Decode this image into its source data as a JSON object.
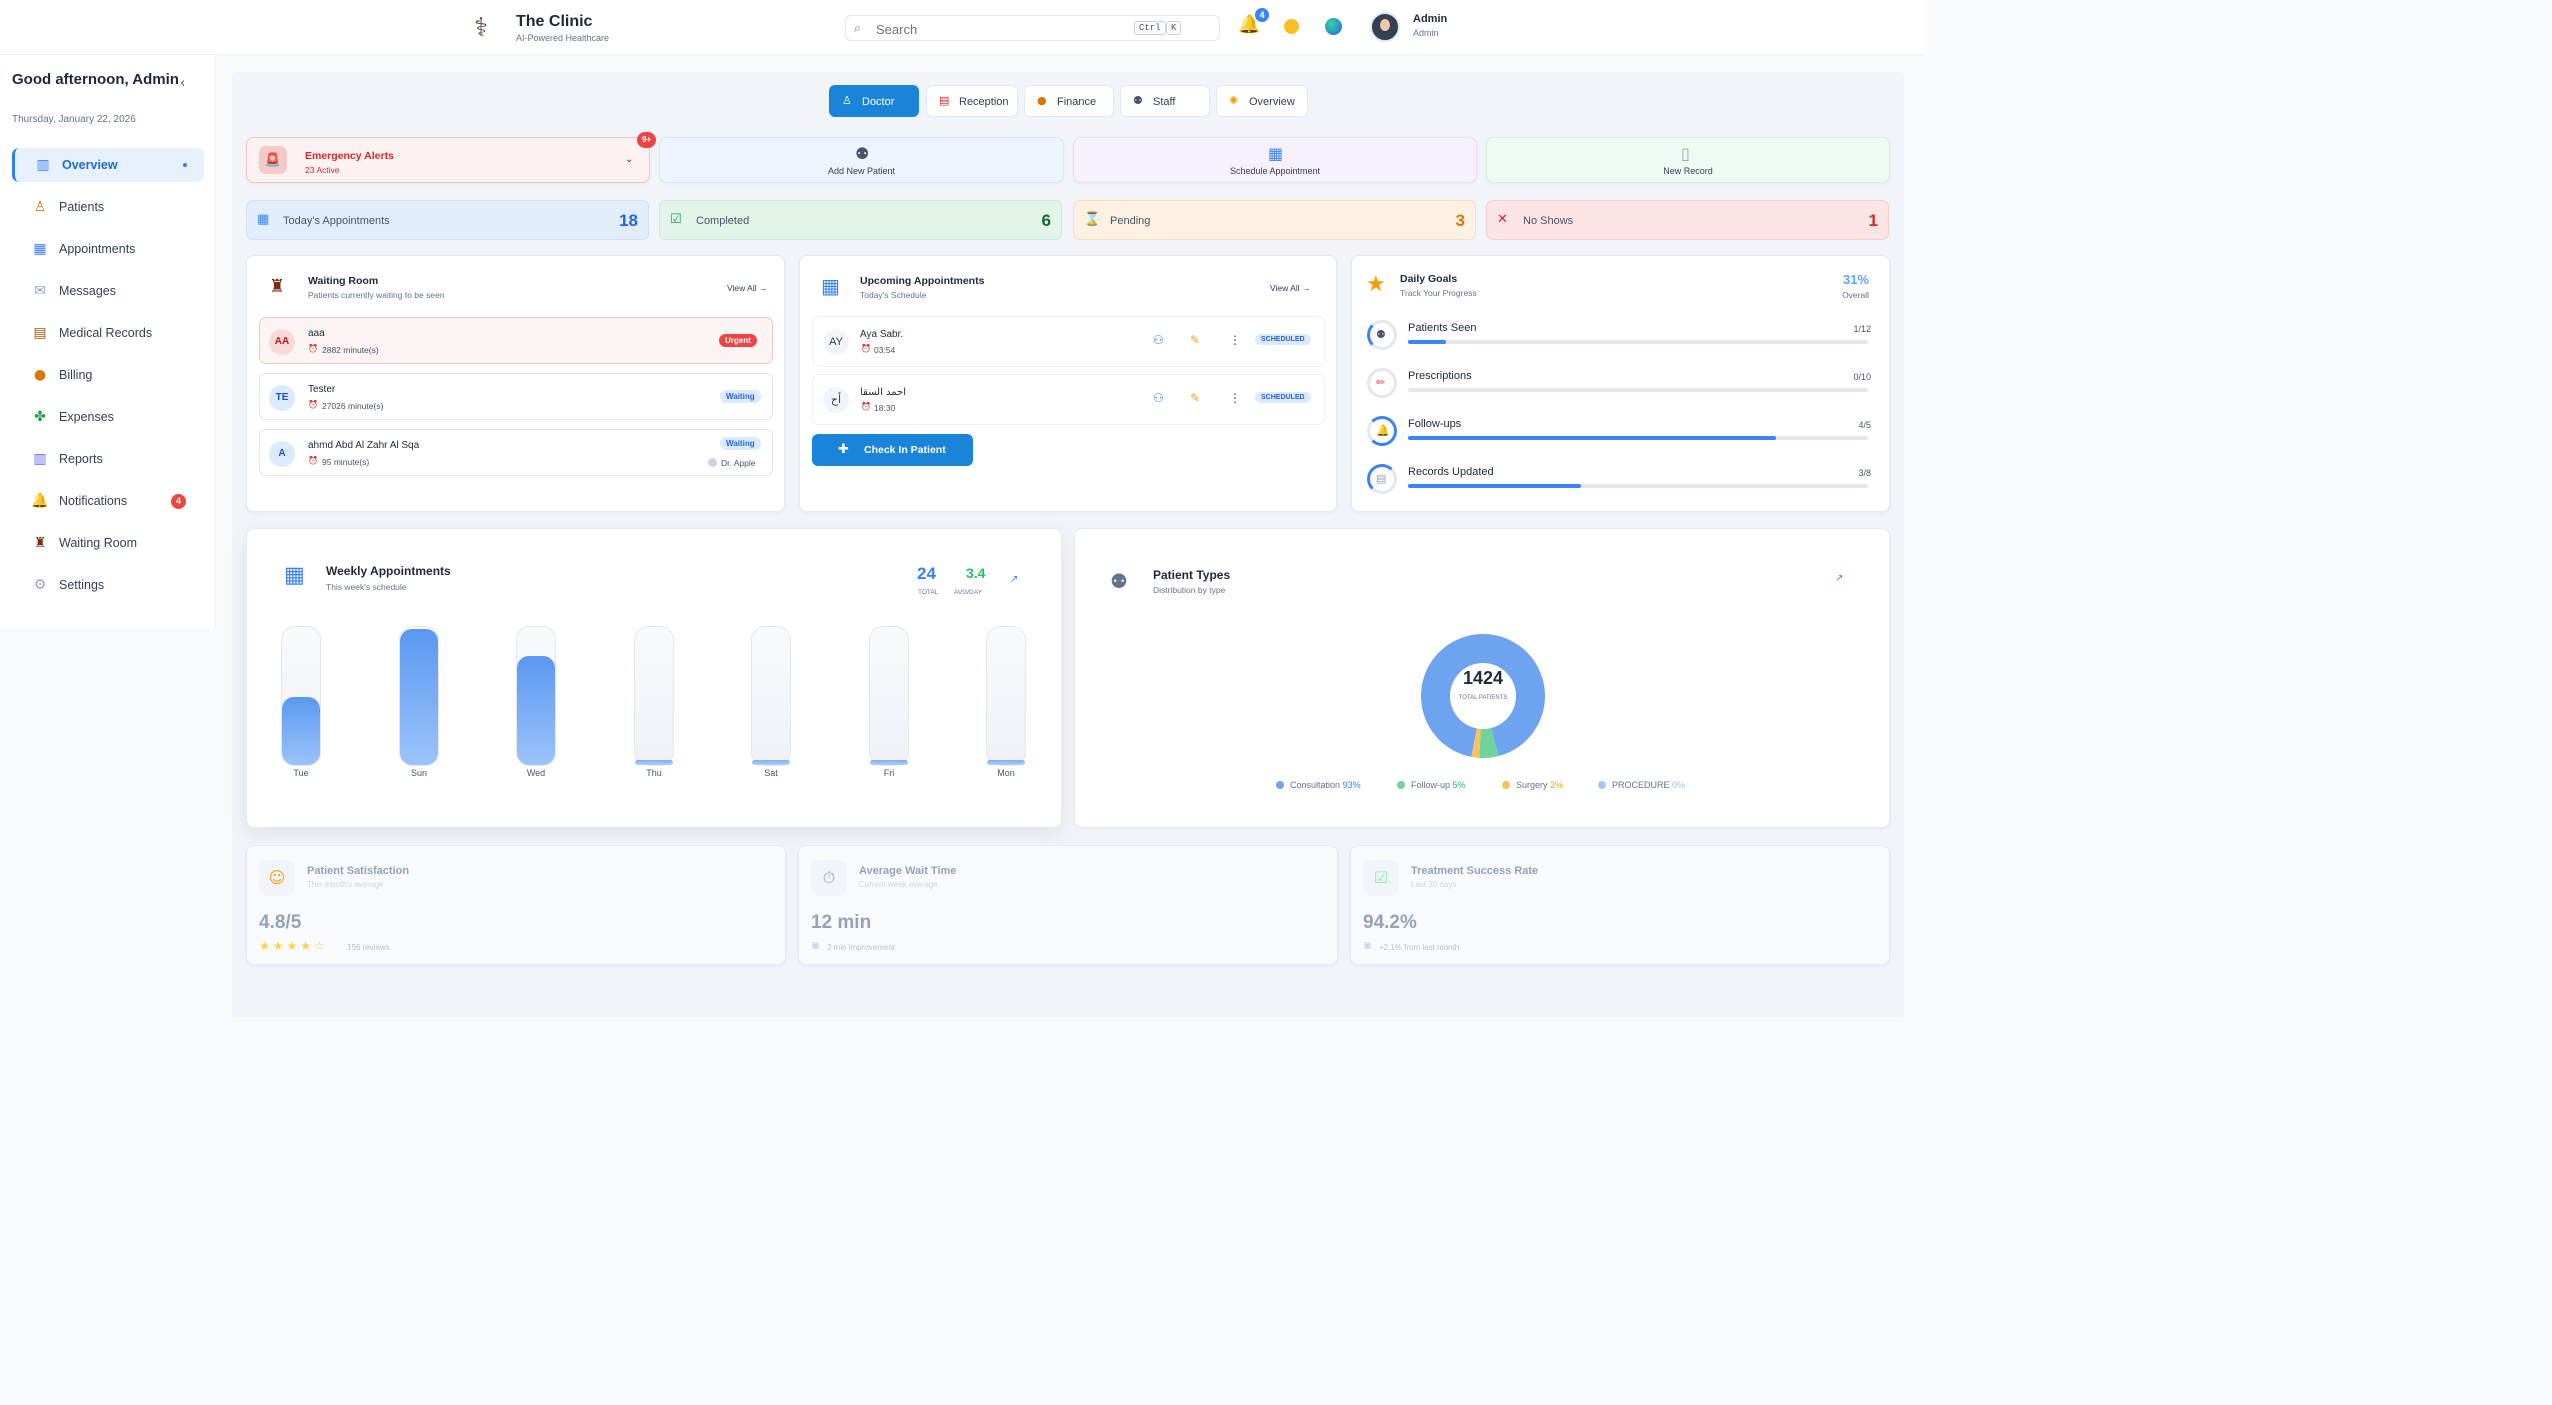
{
  "header": {
    "brand_name": "The Clinic",
    "brand_tagline": "AI-Powered Healthcare",
    "search_placeholder": "Search",
    "shortcut_ctrl": "Ctrl",
    "shortcut_key": "K",
    "notification_count": "4",
    "user_name": "Admin",
    "user_role": "Admin"
  },
  "sidebar": {
    "greeting": "Good afternoon, Admin",
    "date": "Thursday, January 22, 2026",
    "items": [
      {
        "label": "Overview",
        "icon": "bar-chart-icon"
      },
      {
        "label": "Patients",
        "icon": "person-icon"
      },
      {
        "label": "Appointments",
        "icon": "calendar-icon"
      },
      {
        "label": "Messages",
        "icon": "chat-icon"
      },
      {
        "label": "Medical Records",
        "icon": "clipboard-icon"
      },
      {
        "label": "Billing",
        "icon": "money-bag-icon"
      },
      {
        "label": "Expenses",
        "icon": "money-icon"
      },
      {
        "label": "Reports",
        "icon": "chart-icon"
      },
      {
        "label": "Notifications",
        "icon": "bell-icon",
        "badge": "4"
      },
      {
        "label": "Waiting Room",
        "icon": "chair-icon"
      },
      {
        "label": "Settings",
        "icon": "gear-icon"
      }
    ]
  },
  "tabs": [
    "Doctor",
    "Reception",
    "Finance",
    "Staff",
    "Overview"
  ],
  "quick_actions": {
    "emergency_title": "Emergency Alerts",
    "emergency_sub": "23 Active",
    "emergency_badge": "9+",
    "add_patient": "Add New Patient",
    "schedule": "Schedule Appointment",
    "new_record": "New Record"
  },
  "stats": [
    {
      "label": "Today's Appointments",
      "value": "18",
      "color": "#2563eb"
    },
    {
      "label": "Completed",
      "value": "6",
      "color": "#166534"
    },
    {
      "label": "Pending",
      "value": "3",
      "color": "#d97706"
    },
    {
      "label": "No Shows",
      "value": "1",
      "color": "#dc2626"
    }
  ],
  "waiting_room": {
    "title": "Waiting Room",
    "subtitle": "Patients currently waiting to be seen",
    "view_all": "View All →",
    "patients": [
      {
        "initials": "AA",
        "name": "aaa",
        "wait": "2882 minute(s)",
        "status": "Urgent"
      },
      {
        "initials": "TE",
        "name": "Tester",
        "wait": "27026 minute(s)",
        "status": "Waiting"
      },
      {
        "initials": "A",
        "name": "ahmd Abd Al Zahr Al Sqa",
        "wait": "95 minute(s)",
        "status": "Waiting",
        "doctor": "Dr. Apple"
      }
    ]
  },
  "upcoming": {
    "title": "Upcoming Appointments",
    "subtitle": "Today's Schedule",
    "view_all": "View All →",
    "items": [
      {
        "initials": "AY",
        "name": "Aya Sabr.",
        "time": "03:54",
        "status": "SCHEDULED"
      },
      {
        "initials": "أح",
        "name": "احمد السقا",
        "time": "18:30",
        "status": "SCHEDULED"
      }
    ],
    "check_in": "Check In Patient"
  },
  "goals": {
    "title": "Daily Goals",
    "subtitle": "Track Your Progress",
    "overall": "31%",
    "overall_label": "Overall",
    "items": [
      {
        "name": "Patients Seen",
        "value": "1/12",
        "progress": 0.083
      },
      {
        "name": "Prescriptions",
        "value": "0/10",
        "progress": 0
      },
      {
        "name": "Follow-ups",
        "value": "4/5",
        "progress": 0.8
      },
      {
        "name": "Records Updated",
        "value": "3/8",
        "progress": 0.375
      }
    ]
  },
  "weekly": {
    "title": "Weekly Appointments",
    "subtitle": "This week's schedule",
    "total": "24",
    "total_label": "TOTAL",
    "avg": "3.4",
    "avg_label": "AVG/DAY"
  },
  "chart_data": {
    "type": "bar",
    "categories": [
      "Tue",
      "Sun",
      "Wed",
      "Thu",
      "Sat",
      "Fri",
      "Mon"
    ],
    "values": [
      5,
      10,
      8,
      0,
      0,
      0,
      0
    ],
    "ylim": [
      0,
      10
    ]
  },
  "patient_types": {
    "title": "Patient Types",
    "subtitle": "Distribution by type",
    "total": "1424",
    "total_label": "TOTAL PATIENTS",
    "legend": [
      {
        "name": "Consultation",
        "pct": "93%",
        "value": 93,
        "color": "#6ea3f0"
      },
      {
        "name": "Follow-up",
        "pct": "5%",
        "value": 5,
        "color": "#6fd39a"
      },
      {
        "name": "Surgery",
        "pct": "2%",
        "value": 2,
        "color": "#f7c35b"
      },
      {
        "name": "PROCEDURE",
        "pct": "0%",
        "value": 0,
        "color": "#a9c6f2"
      }
    ]
  },
  "kpis": [
    {
      "title": "Patient Satisfaction",
      "sub": "This month's average",
      "value": "4.8/5",
      "note": "156 reviews"
    },
    {
      "title": "Average Wait Time",
      "sub": "Current week average",
      "value": "12 min",
      "note": "3 min improvement"
    },
    {
      "title": "Treatment Success Rate",
      "sub": "Last 30 days",
      "value": "94.2%",
      "note": "+2.1% from last month"
    }
  ]
}
